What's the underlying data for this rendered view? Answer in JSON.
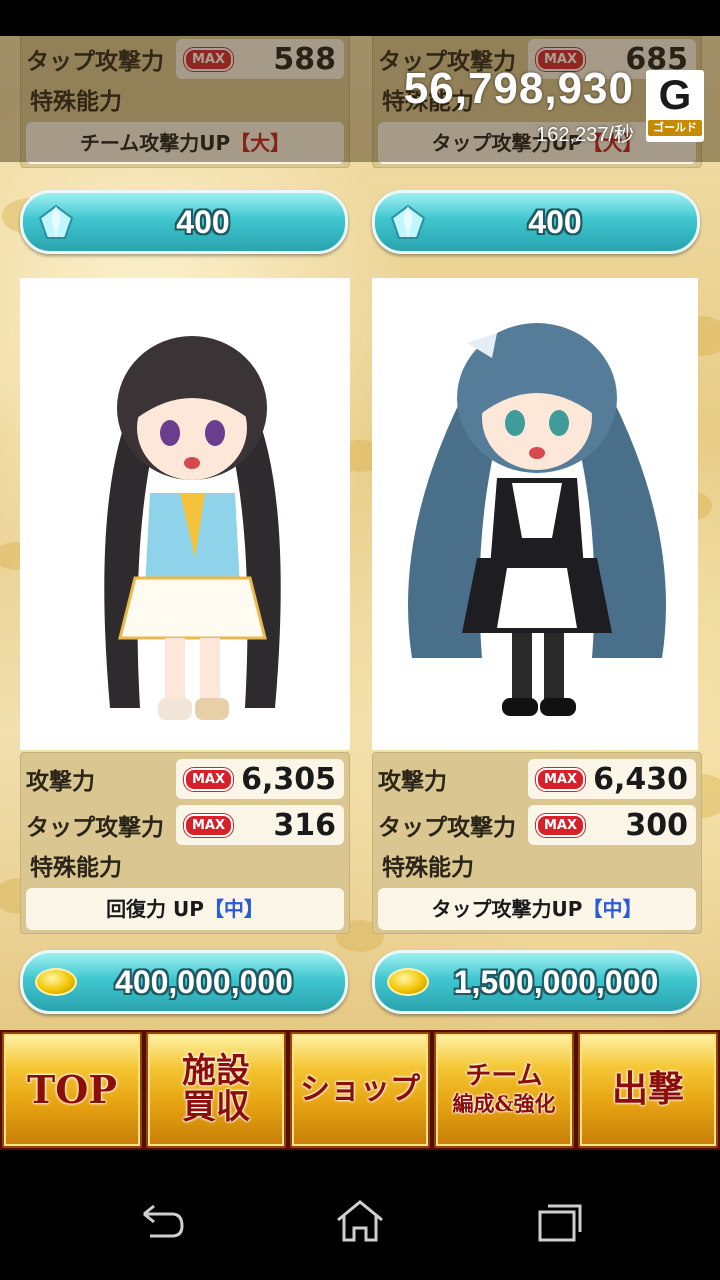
{
  "gold": {
    "amount": "56,798,930",
    "rate": "162,237/秒",
    "icon_letter": "G",
    "icon_label": "ゴールド"
  },
  "cards_top": [
    {
      "tap_label": "タップ攻撃力",
      "max_label": "MAX",
      "tap_value": "588",
      "special_label": "特殊能力",
      "special_text": "チーム攻撃力UP",
      "special_tag": "【大】",
      "price": "400"
    },
    {
      "tap_label": "タップ攻撃力",
      "max_label": "MAX",
      "tap_value": "685",
      "special_label": "特殊能力",
      "special_text": "タップ攻撃力UP",
      "special_tag": "【大】",
      "price": "400"
    }
  ],
  "cards": [
    {
      "atk_label": "攻撃力",
      "atk_value": "6,305",
      "tap_label": "タップ攻撃力",
      "tap_value": "316",
      "max_label": "MAX",
      "special_label": "特殊能力",
      "special_text": "回復力 UP",
      "special_tag": "【中】",
      "price": "400,000,000"
    },
    {
      "atk_label": "攻撃力",
      "atk_value": "6,430",
      "tap_label": "タップ攻撃力",
      "tap_value": "300",
      "max_label": "MAX",
      "special_label": "特殊能力",
      "special_text": "タップ攻撃力UP",
      "special_tag": "【中】",
      "price": "1,500,000,000"
    }
  ],
  "nav": {
    "top": "TOP",
    "facility_1": "施設",
    "facility_2": "買収",
    "shop": "ショップ",
    "team_1": "チーム",
    "team_2": "編成&強化",
    "sortie": "出撃"
  },
  "colors": {
    "max_badge": "#d8202a",
    "pill": "#3fc6cf",
    "nav_text": "#8b0e0a"
  }
}
